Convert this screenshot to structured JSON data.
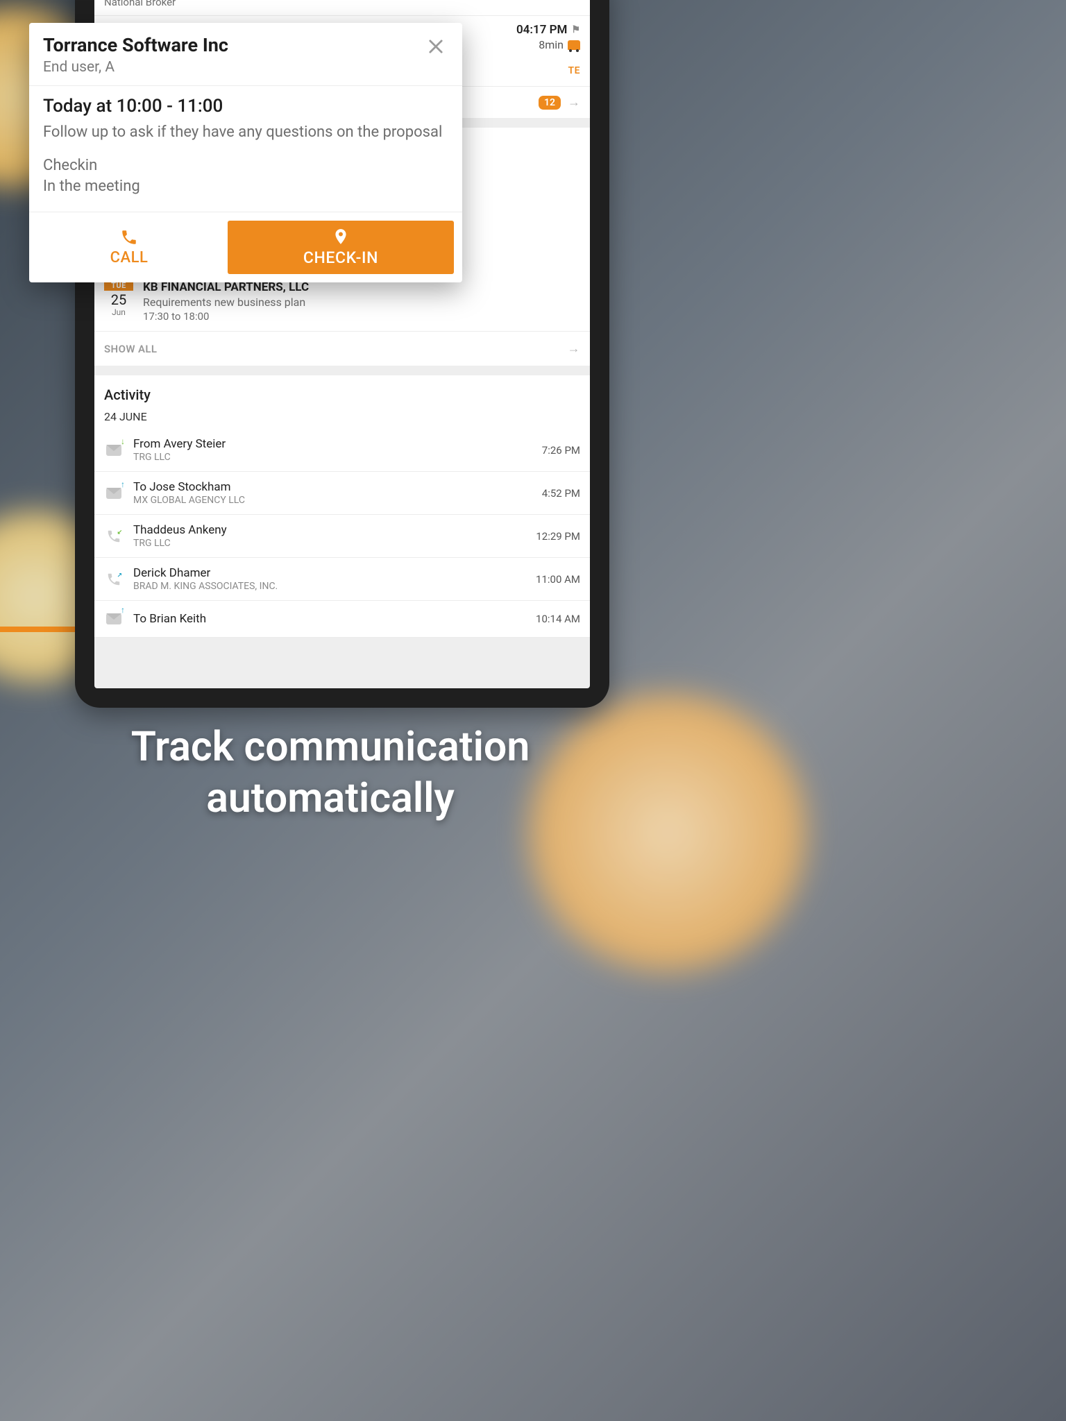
{
  "background_note_top": "National Broker",
  "eta": {
    "time": "04:17 PM",
    "duration": "8min"
  },
  "te_label": "TE",
  "badge_count": "12",
  "event": {
    "dow": "TUE",
    "day": "25",
    "month": "Jun",
    "title": "KB FINANCIAL PARTNERS, LLC",
    "subtitle": "Requirements new business plan",
    "time": "17:30 to 18:00"
  },
  "show_all": "SHOW ALL",
  "activity": {
    "header": "Activity",
    "date": "24 JUNE",
    "items": [
      {
        "kind": "mail-in",
        "title": "From Avery Steier",
        "sub": "TRG LLC",
        "time": "7:26 PM"
      },
      {
        "kind": "mail-out",
        "title": "To Jose Stockham",
        "sub": "MX GLOBAL AGENCY LLC",
        "time": "4:52 PM"
      },
      {
        "kind": "call-in",
        "title": "Thaddeus Ankeny",
        "sub": "TRG LLC",
        "time": "12:29 PM"
      },
      {
        "kind": "call-out",
        "title": "Derick Dhamer",
        "sub": "BRAD M. KING ASSOCIATES, INC.",
        "time": "11:00 AM"
      },
      {
        "kind": "mail-out",
        "title": "To Brian Keith",
        "sub": "",
        "time": "10:14 AM"
      }
    ]
  },
  "modal": {
    "title": "Torrance Software Inc",
    "subtitle": "End user, A",
    "time": "Today at 10:00 - 11:00",
    "description": "Follow up to ask if they have any questions on the proposal",
    "status1": "Checkin",
    "status2": "In the meeting",
    "call": "CALL",
    "checkin": "CHECK-IN"
  },
  "tagline": "Track communication automatically"
}
